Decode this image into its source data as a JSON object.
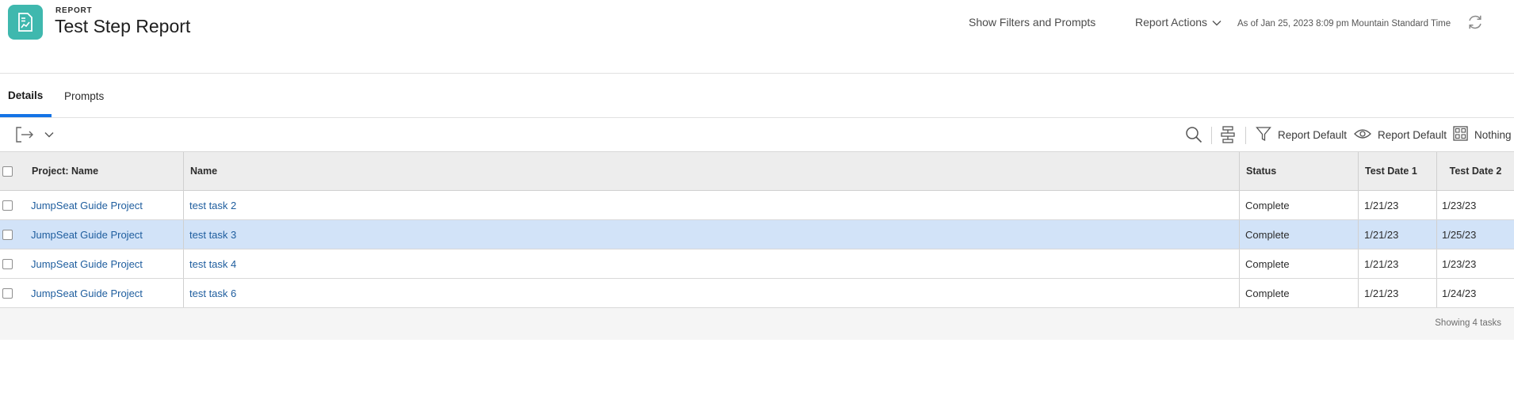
{
  "header": {
    "kicker": "REPORT",
    "title": "Test Step Report",
    "show_filters": "Show Filters and Prompts",
    "report_actions": "Report Actions",
    "as_of": "As of Jan 25, 2023 8:09 pm Mountain Standard Time",
    "icons": {
      "app": "report-chart-icon",
      "actions": "chevron-down-icon",
      "refresh": "refresh-icon"
    }
  },
  "tabs": [
    {
      "label": "Details",
      "active": true
    },
    {
      "label": "Prompts",
      "active": false
    }
  ],
  "toolbar": {
    "filter_label": "Report Default",
    "view_label": "Report Default",
    "grouping_label": "Nothing",
    "icons": [
      "export-icon",
      "chevron-down-icon",
      "search-icon",
      "grouping-tree-icon",
      "filter-icon",
      "eye-icon",
      "grid-icon"
    ]
  },
  "table": {
    "columns": [
      "Project: Name",
      "Name",
      "Status",
      "Test Date 1",
      "Test Date 2"
    ],
    "rows": [
      {
        "project": "JumpSeat Guide Project",
        "name": "test task 2",
        "status": "Complete",
        "date1": "1/21/23",
        "date2": "1/23/23",
        "selected": false
      },
      {
        "project": "JumpSeat Guide Project",
        "name": "test task 3",
        "status": "Complete",
        "date1": "1/21/23",
        "date2": "1/25/23",
        "selected": true
      },
      {
        "project": "JumpSeat Guide Project",
        "name": "test task 4",
        "status": "Complete",
        "date1": "1/21/23",
        "date2": "1/23/23",
        "selected": false
      },
      {
        "project": "JumpSeat Guide Project",
        "name": "test task 6",
        "status": "Complete",
        "date1": "1/21/23",
        "date2": "1/24/23",
        "selected": false
      }
    ],
    "footer": "Showing 4 tasks"
  },
  "colors": {
    "accent": "#1473e6",
    "app_icon": "#3fb8ae",
    "link": "#1e5d9e",
    "selected_row": "#d2e3f8"
  }
}
